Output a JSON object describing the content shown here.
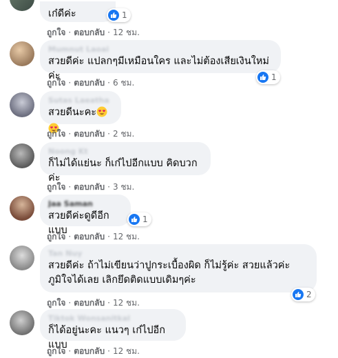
{
  "ui": {
    "like_label": "ถูกใจ",
    "reply_label": "ตอบกลับ",
    "sep": "·"
  },
  "comments": [
    {
      "author": "",
      "text": "เก๋ดีค่ะ",
      "time": "12 ชม.",
      "reactions": "1"
    },
    {
      "author": "Mumnut Laoai",
      "text": "สวยดีค่ะ แปลกๆมีเหมือนใคร และไม่ต้องเสียเงินใหม่ค่ะ",
      "time": "6 ชม.",
      "reactions": "1"
    },
    {
      "author": "Sutas Laeatha",
      "text": "สวยดีนะคะ",
      "time": "2 ชม.",
      "reactions": ""
    },
    {
      "author": "Noong Kt",
      "text": "ก็ไม่ได้แย่นะ ก็เก๋ไปอีกแบบ คิดบวกค่ะ",
      "time": "3 ชม.",
      "reactions": ""
    },
    {
      "author": "Jaa Saman",
      "text": "สวยดีค่ะดูดีอีกแบบ",
      "time": "12 ชม.",
      "reactions": "1"
    },
    {
      "author": "Tan Nuy",
      "text": "สวยดีค่ะ ถ้าไม่เขียนว่าปูกระเบื้องผิด ก็ไม่รู้ค่ะ สวยแล้วค่ะ ภูมิใจได้เลย เลิกยึดติดแบบเดิมๆค่ะ",
      "time": "12 ชม.",
      "reactions": "2"
    },
    {
      "author": "Tiktok Wonsanitkal",
      "text": "ก็ได้อยู่นะคะ แนวๆ เก๋ไปอีกแบบ",
      "time": "12 ชม.",
      "reactions": ""
    }
  ],
  "colors": {
    "bubble": "#f0f2f5",
    "meta": "#65676b",
    "like_blue": "#1877f2"
  },
  "icons": {
    "like": "like-icon",
    "heart_eyes": "heart-eyes-emoji"
  }
}
